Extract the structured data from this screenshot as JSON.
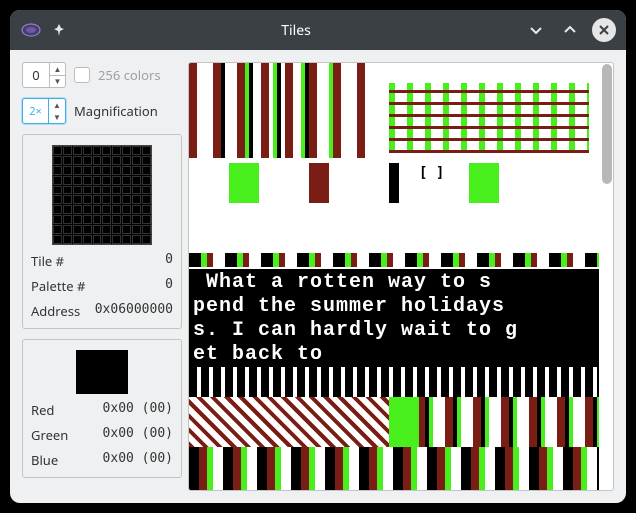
{
  "window": {
    "title": "Tiles"
  },
  "controls": {
    "palette_index": "0",
    "colors256_label": "256 colors",
    "colors256_checked": false,
    "magnification_value": "2×",
    "magnification_label": "Magnification"
  },
  "tileinfo": {
    "tile_label": "Tile #",
    "tile_value": "0",
    "palette_label": "Palette #",
    "palette_value": "0",
    "address_label": "Address",
    "address_value": "0x06000000"
  },
  "color": {
    "swatch": "#000000",
    "red_label": "Red",
    "red_value": "0x00 (00)",
    "green_label": "Green",
    "green_value": "0x00 (00)",
    "blue_label": "Blue",
    "blue_value": "0x00 (00)"
  },
  "viewer": {
    "bracket_overlay": "[ ]",
    "text_line1": " What a rotten way to s",
    "text_line2": "pend the summer holidays",
    "text_line3": "s. I can hardly wait to g",
    "text_line4": "et back to"
  }
}
